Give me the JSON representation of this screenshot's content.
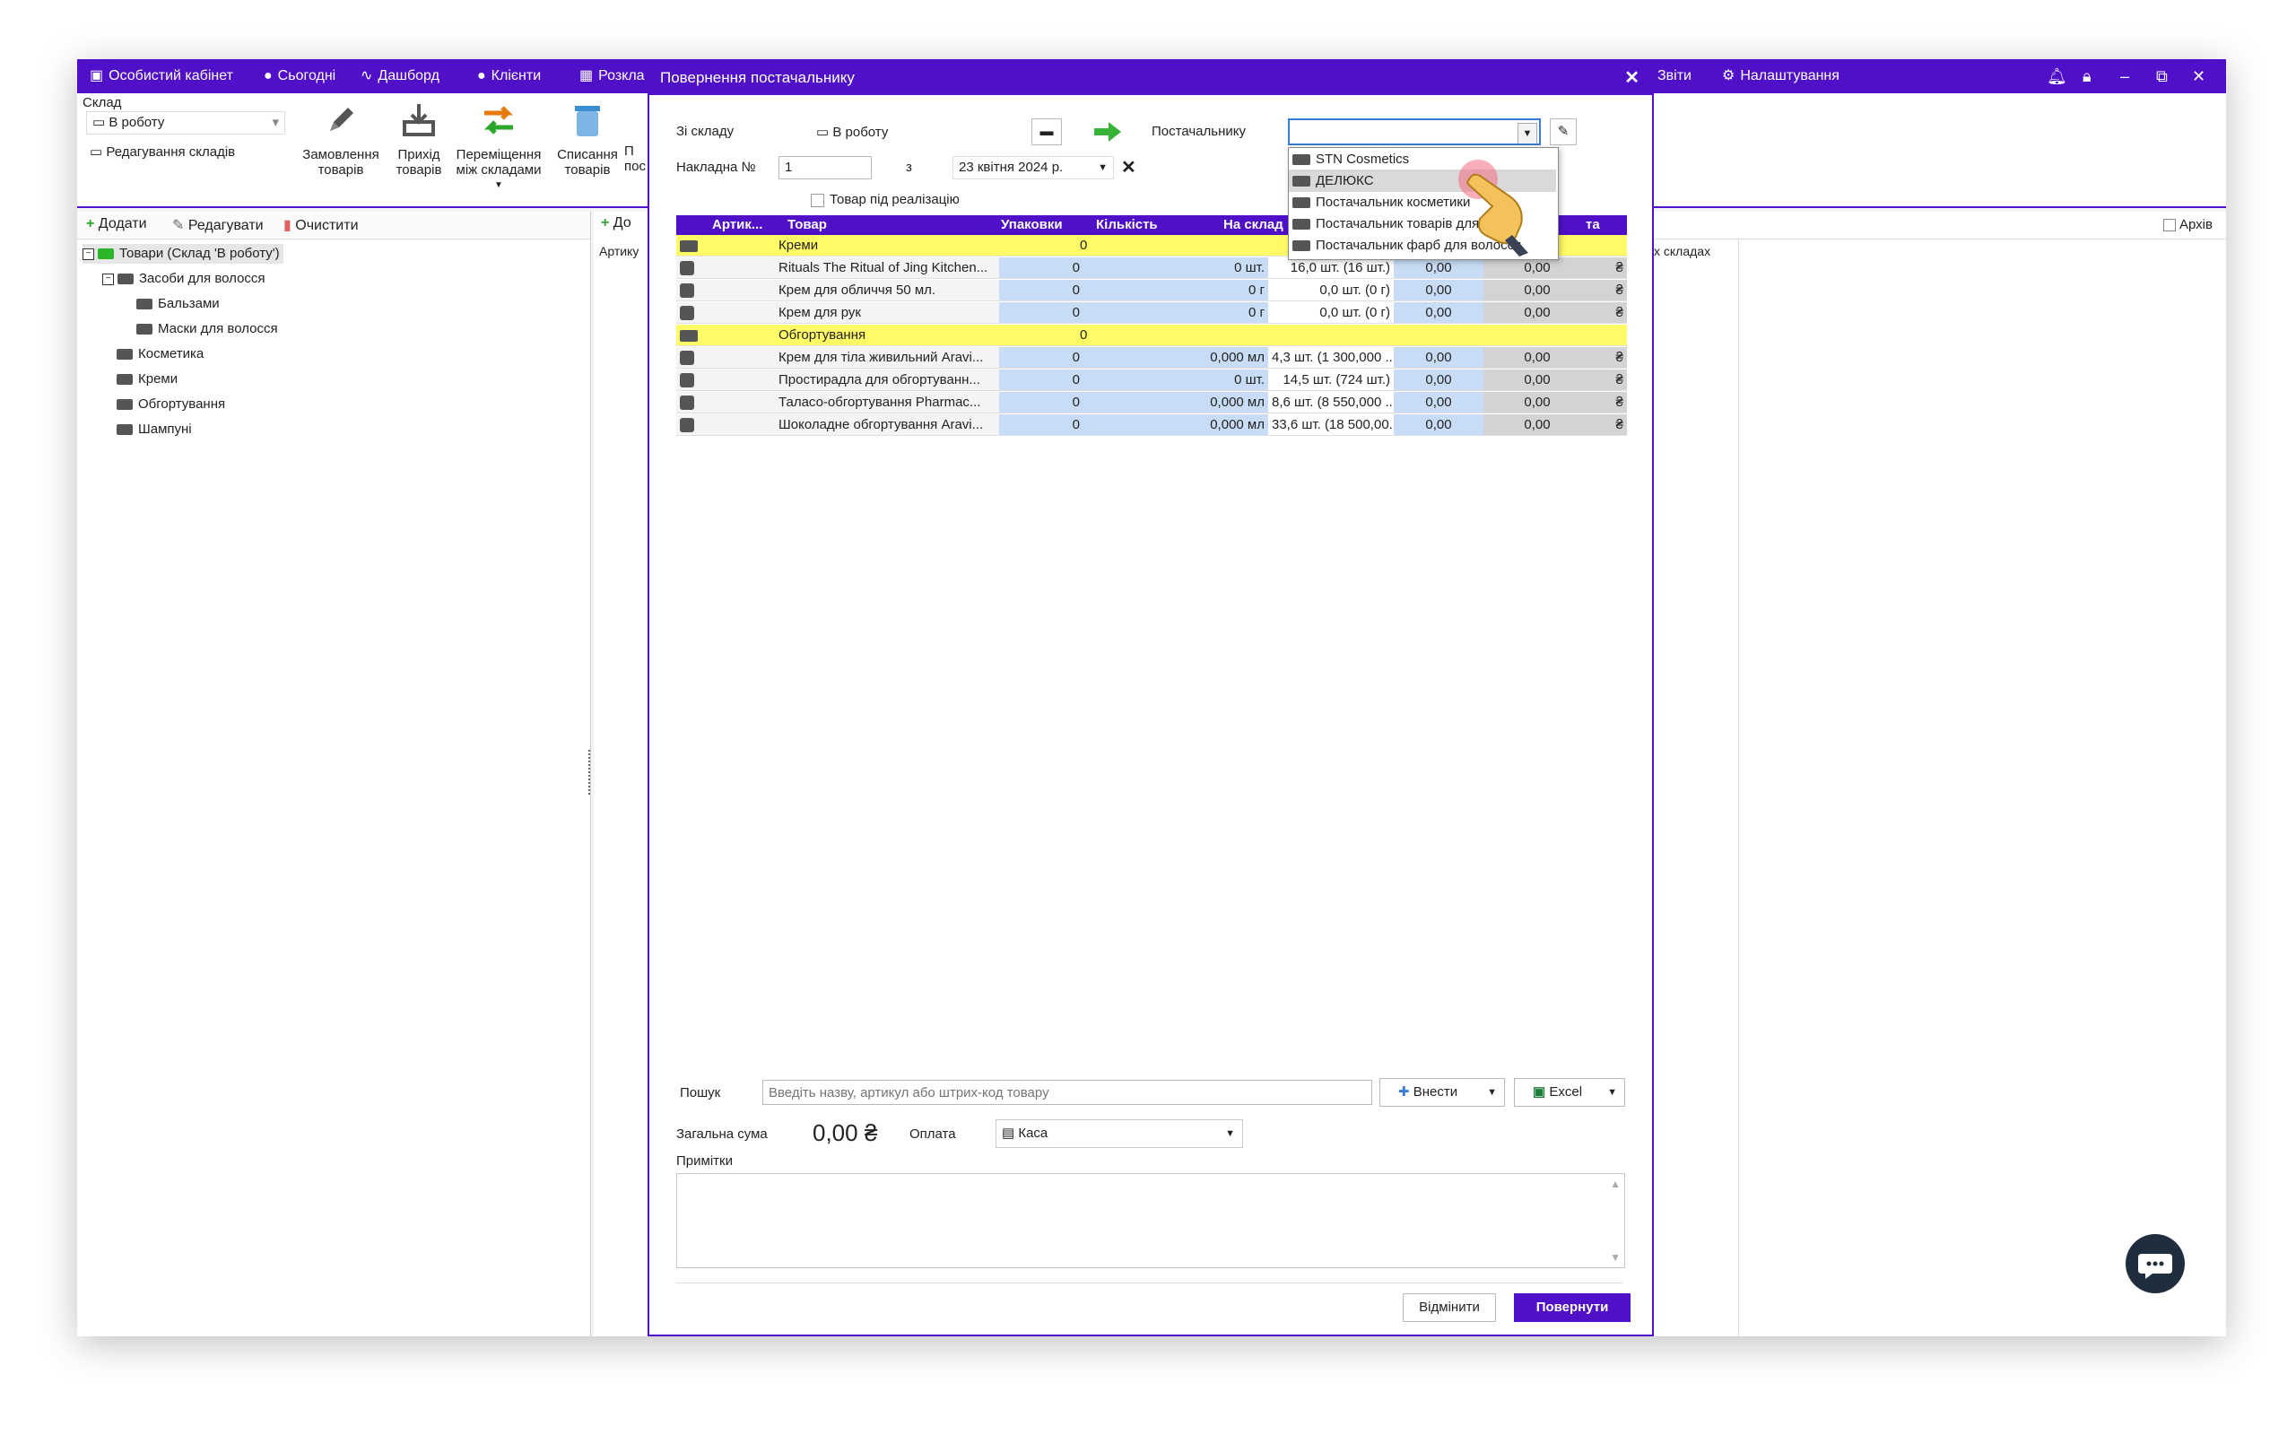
{
  "topbar": {
    "items": [
      "Особистий кабінет",
      "Сьогодні",
      "Дашборд",
      "Клієнти",
      "Розкла"
    ],
    "right_items": [
      "Звіти",
      "Налаштування"
    ]
  },
  "ribbon": {
    "warehouse_label": "Склад",
    "warehouse_value": "В роботу",
    "edit_warehouses": "Редагування складів",
    "buttons": [
      {
        "line1": "Замовлення",
        "line2": "товарів"
      },
      {
        "line1": "Прихід",
        "line2": "товарів"
      },
      {
        "line1": "Переміщення",
        "line2": "між складами"
      },
      {
        "line1": "Списання",
        "line2": "товарів"
      },
      {
        "line1": "П",
        "line2": "пос"
      }
    ]
  },
  "left_panel": {
    "toolbar": {
      "add": "Додати",
      "edit": "Редагувати",
      "clear": "Очистити"
    },
    "tree": [
      "Товари (Склад 'В роботу')",
      "Засоби для волосся",
      "Бальзами",
      "Маски для волосся",
      "Косметика",
      "Креми",
      "Обгортування",
      "Шампуні"
    ]
  },
  "mid_panel": {
    "add": "До",
    "col": "Артику"
  },
  "right_panel": {
    "archive": "Архів",
    "col": "х складах"
  },
  "dialog": {
    "title": "Повернення постачальнику",
    "from_warehouse_label": "Зі складу",
    "from_warehouse_value": "В роботу",
    "supplier_label": "Постачальнику",
    "invoice_label": "Накладна №",
    "invoice_value": "1",
    "date_from_label": "з",
    "date_value": "23 квітня 2024 р.",
    "consignment_label": "Товар під реалізацію",
    "grid_headers": [
      "Артик...",
      "Товар",
      "Упаковки",
      "Кількість",
      "На склад",
      "та"
    ],
    "rows": [
      {
        "type": "category",
        "name": "Креми",
        "packs": "0"
      },
      {
        "type": "item",
        "name": "Rituals The Ritual of Jing Kitchen...",
        "packs": "0",
        "qty": "0 шт.",
        "stock": "16,0 шт. (16 шт.)",
        "c5": "0,00",
        "c6": "0,00",
        "cur": "₴"
      },
      {
        "type": "item",
        "name": "Крем для обличчя 50 мл.",
        "packs": "0",
        "qty": "0 г",
        "stock": "0,0 шт. (0 г)",
        "c5": "0,00",
        "c6": "0,00",
        "cur": "₴"
      },
      {
        "type": "item",
        "name": "Крем для рук",
        "packs": "0",
        "qty": "0 г",
        "stock": "0,0 шт. (0 г)",
        "c5": "0,00",
        "c6": "0,00",
        "cur": "₴"
      },
      {
        "type": "category",
        "name": "Обгортування",
        "packs": "0"
      },
      {
        "type": "item",
        "name": "Крем для тіла живильний Aravi...",
        "packs": "0",
        "qty": "0,000 мл",
        "stock": "4,3 шт. (1 300,000 ...",
        "c5": "0,00",
        "c6": "0,00",
        "cur": "₴"
      },
      {
        "type": "item",
        "name": "Простирадла для обгортуванн...",
        "packs": "0",
        "qty": "0 шт.",
        "stock": "14,5 шт. (724 шт.)",
        "c5": "0,00",
        "c6": "0,00",
        "cur": "₴"
      },
      {
        "type": "item",
        "name": "Таласо-обгортування Pharmac...",
        "packs": "0",
        "qty": "0,000 мл",
        "stock": "8,6 шт. (8 550,000 ...",
        "c5": "0,00",
        "c6": "0,00",
        "cur": "₴"
      },
      {
        "type": "item",
        "name": "Шоколадне обгортування Aravi...",
        "packs": "0",
        "qty": "0,000 мл",
        "stock": "33,6 шт. (18 500,00...",
        "c5": "0,00",
        "c6": "0,00",
        "cur": "₴"
      }
    ],
    "supplier_options": [
      "STN Cosmetics",
      "ДЕЛЮКС",
      "Постачальник косметики",
      "Постачальник товарів для",
      "Постачальник фарб для волосся"
    ],
    "search_label": "Пошук",
    "search_placeholder": "Введіть назву, артикул або штрих-код товару",
    "insert_button": "Внести",
    "excel_button": "Excel",
    "total_label": "Загальна сума",
    "total_value": "0,00 ₴",
    "payment_label": "Оплата",
    "payment_value": "Каса",
    "notes_label": "Примітки",
    "cancel_button": "Відмінити",
    "return_button": "Повернути"
  },
  "colors": {
    "accent": "#5010c8",
    "category_row": "#fffb66",
    "qty_cell": "#c9dcf5"
  }
}
